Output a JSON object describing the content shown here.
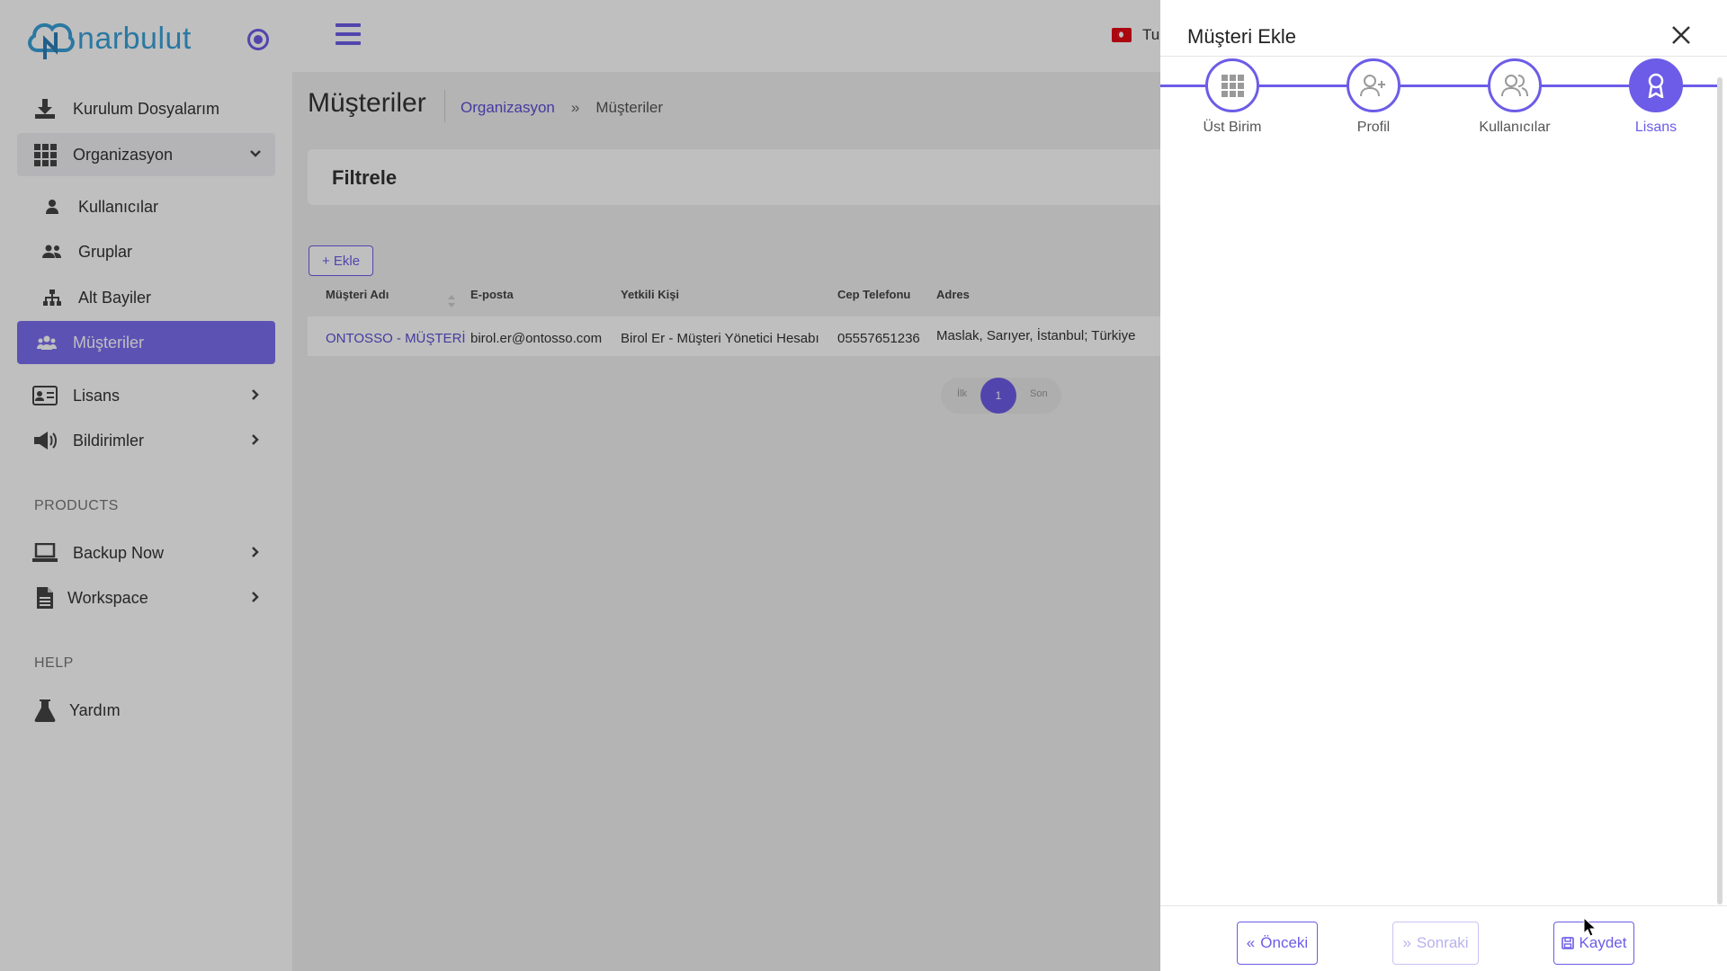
{
  "brand": {
    "name": "narbulut"
  },
  "sidebar": {
    "items": [
      {
        "label": "Kurulum Dosyalarım",
        "icon": "download-icon"
      },
      {
        "label": "Organizasyon",
        "icon": "grid-icon"
      },
      {
        "label": "Kullanıcılar",
        "icon": "user-icon"
      },
      {
        "label": "Gruplar",
        "icon": "users-icon"
      },
      {
        "label": "Alt Bayiler",
        "icon": "sitemap-icon"
      },
      {
        "label": "Müşteriler",
        "icon": "users-group-icon"
      },
      {
        "label": "Lisans",
        "icon": "id-card-icon"
      },
      {
        "label": "Bildirimler",
        "icon": "megaphone-icon"
      },
      {
        "label": "Backup Now",
        "icon": "laptop-icon"
      },
      {
        "label": "Workspace",
        "icon": "file-icon"
      },
      {
        "label": "Yardım",
        "icon": "flask-icon"
      }
    ],
    "sections": {
      "products": "PRODUCTS",
      "help": "HELP"
    }
  },
  "header": {
    "language": "Tu"
  },
  "page": {
    "title": "Müşteriler",
    "breadcrumb": {
      "parent": "Organizasyon",
      "separator": "»",
      "current": "Müşteriler"
    },
    "filter_title": "Filtrele",
    "add_button": "+ Ekle"
  },
  "table": {
    "columns": [
      "Müşteri Adı",
      "E-posta",
      "Yetkili Kişi",
      "Cep Telefonu",
      "Adres"
    ],
    "rows": [
      {
        "name": "ONTOSSO - MÜŞTERİ",
        "email": "birol.er@ontosso.com",
        "contact": "Birol Er - Müşteri Yönetici Hesabı",
        "phone": "05557651236",
        "address": "Maslak, Sarıyer, İstanbul; Türkiye"
      }
    ]
  },
  "pagination": {
    "first": "İlk",
    "current": "1",
    "last": "Son"
  },
  "drawer": {
    "title": "Müşteri Ekle",
    "steps": [
      {
        "label": "Üst Birim",
        "icon": "grid-icon",
        "active": false
      },
      {
        "label": "Profil",
        "icon": "user-plus-icon",
        "active": false
      },
      {
        "label": "Kullanıcılar",
        "icon": "users-icon",
        "active": false
      },
      {
        "label": "Lisans",
        "icon": "award-icon",
        "active": true
      }
    ],
    "buttons": {
      "prev": "Önceki",
      "next": "Sonraki",
      "save": "Kaydet"
    }
  },
  "colors": {
    "accent": "#6c5ce7",
    "brand": "#3aa0d8"
  }
}
